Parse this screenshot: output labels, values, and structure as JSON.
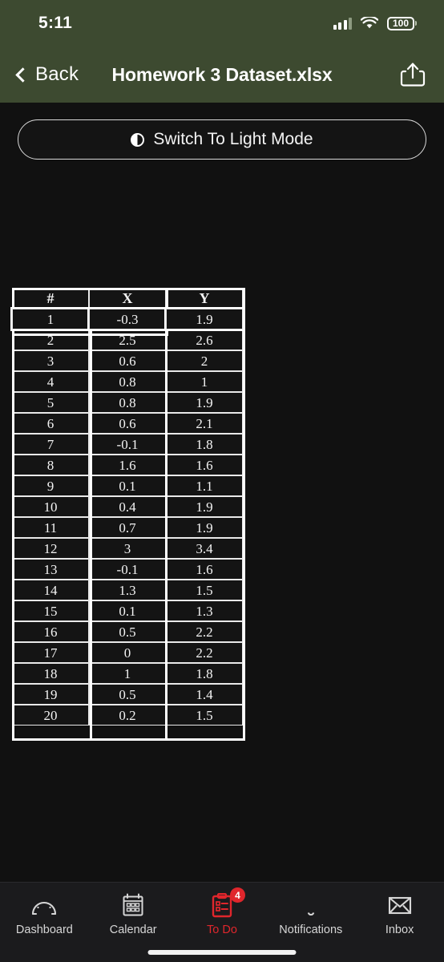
{
  "status_bar": {
    "time": "5:11",
    "battery_level": "100",
    "signal_icon": "cellular-bars-icon",
    "wifi_icon": "wifi-icon",
    "battery_icon": "battery-icon"
  },
  "nav_bar": {
    "back_label": "Back",
    "back_icon": "chevron-left-icon",
    "title": "Homework 3 Dataset.xlsx",
    "share_icon": "share-icon"
  },
  "main": {
    "mode_button_label": "Switch To Light Mode",
    "mode_button_icon": "half-circle-contrast-icon"
  },
  "colors": {
    "header_green": "#3d4a30",
    "background": "#111111",
    "accent_red": "#e0262c",
    "text_primary": "#ffffff"
  },
  "table": {
    "headers": [
      "#",
      "X",
      "Y"
    ],
    "selected_row_index": 0,
    "rows": [
      [
        "1",
        "-0.3",
        "1.9"
      ],
      [
        "2",
        "2.5",
        "2.6"
      ],
      [
        "3",
        "0.6",
        "2"
      ],
      [
        "4",
        "0.8",
        "1"
      ],
      [
        "5",
        "0.8",
        "1.9"
      ],
      [
        "6",
        "0.6",
        "2.1"
      ],
      [
        "7",
        "-0.1",
        "1.8"
      ],
      [
        "8",
        "1.6",
        "1.6"
      ],
      [
        "9",
        "0.1",
        "1.1"
      ],
      [
        "10",
        "0.4",
        "1.9"
      ],
      [
        "11",
        "0.7",
        "1.9"
      ],
      [
        "12",
        "3",
        "3.4"
      ],
      [
        "13",
        "-0.1",
        "1.6"
      ],
      [
        "14",
        "1.3",
        "1.5"
      ],
      [
        "15",
        "0.1",
        "1.3"
      ],
      [
        "16",
        "0.5",
        "2.2"
      ],
      [
        "17",
        "0",
        "2.2"
      ],
      [
        "18",
        "1",
        "1.8"
      ],
      [
        "19",
        "0.5",
        "1.4"
      ],
      [
        "20",
        "0.2",
        "1.5"
      ]
    ]
  },
  "tab_bar": {
    "items": [
      {
        "label": "Dashboard",
        "icon": "gauge-icon",
        "active": false,
        "badge": null
      },
      {
        "label": "Calendar",
        "icon": "calendar-icon",
        "active": false,
        "badge": null
      },
      {
        "label": "To Do",
        "icon": "clipboard-icon",
        "active": true,
        "badge": "4"
      },
      {
        "label": "Notifications",
        "icon": "bell-icon",
        "active": false,
        "badge": null
      },
      {
        "label": "Inbox",
        "icon": "envelope-icon",
        "active": false,
        "badge": null
      }
    ]
  }
}
